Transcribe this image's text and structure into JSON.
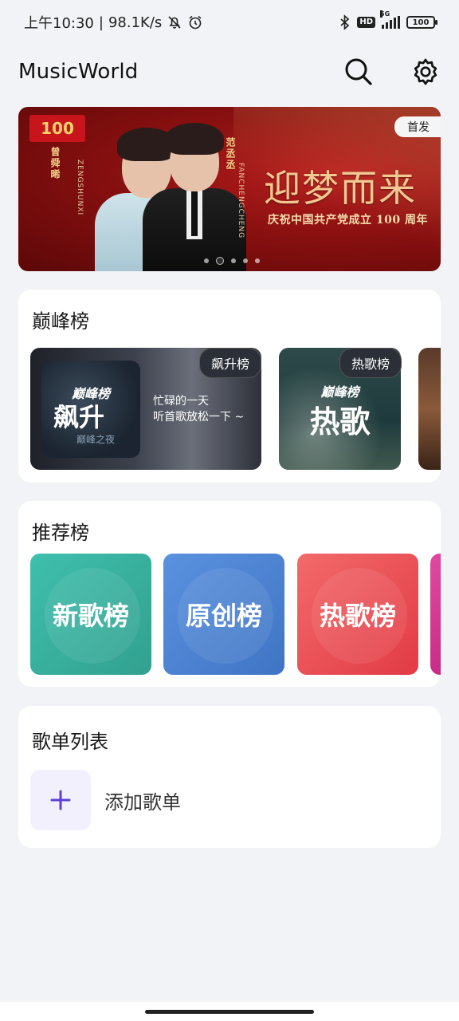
{
  "status_bar": {
    "time": "上午10:30",
    "speed": "98.1K/s",
    "hd": "HD",
    "network": "5G",
    "battery": "100"
  },
  "header": {
    "title": "MusicWorld",
    "icons": [
      "search-icon",
      "gear-icon"
    ]
  },
  "banner": {
    "headline": "迎梦而来",
    "subline": "庆祝中国共产党成立 100 周年",
    "tag": "首发",
    "logo_text": "100",
    "name_left": "曾舜晞",
    "pinyin_left": "ZENGSHUNXI",
    "name_right": "范丞丞",
    "pinyin_right": "FANCHENGCHENG",
    "page_count": 5,
    "active_page": 2
  },
  "peak_section": {
    "title": "巅峰榜",
    "items": [
      {
        "badge": "飙升榜",
        "brand": "巅峰榜",
        "cover_title": "飙升",
        "cover_sub": "巅峰之夜",
        "desc_line1": "忙碌的一天",
        "desc_line2": "听首歌放松一下 ~"
      },
      {
        "badge": "热歌榜",
        "brand": "巅峰榜",
        "cover_title": "热歌"
      }
    ]
  },
  "recommend_section": {
    "title": "推荐榜",
    "items": [
      "新歌榜",
      "原创榜",
      "热歌榜"
    ],
    "colors": [
      "#3fbfad",
      "#5b92df",
      "#f26a6a",
      "#e04aa0"
    ]
  },
  "playlist_section": {
    "title": "歌单列表",
    "add_label": "添加歌单",
    "accent": "#5b3fd6"
  }
}
